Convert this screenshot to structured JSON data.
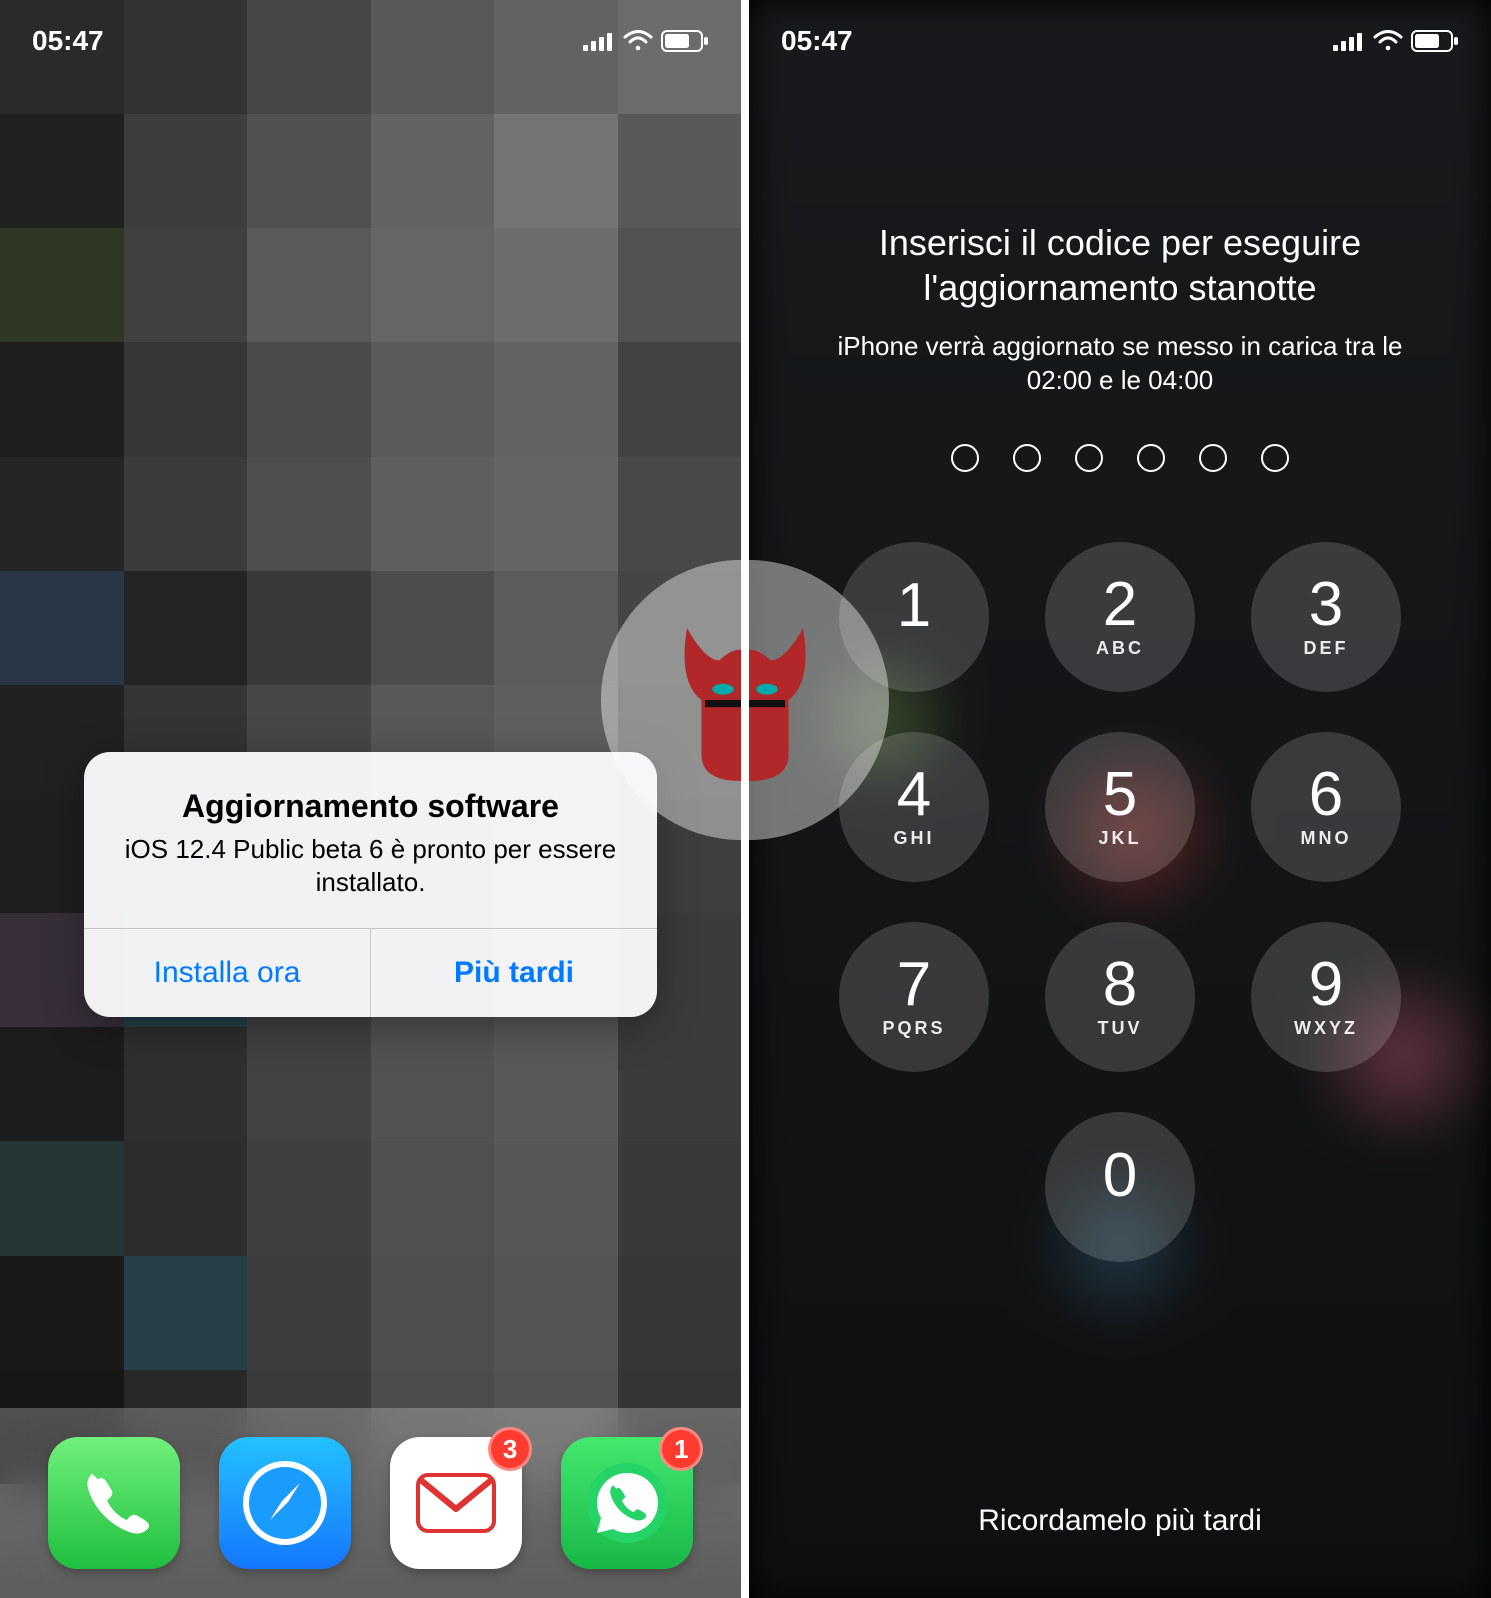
{
  "status": {
    "time": "05:47"
  },
  "left": {
    "alert": {
      "title": "Aggiornamento software",
      "message": "iOS 12.4 Public beta 6 è pronto per essere installato.",
      "primary": "Installa ora",
      "secondary": "Più tardi"
    },
    "dock": {
      "items": [
        {
          "name": "phone",
          "color": "#34c759",
          "badge": null
        },
        {
          "name": "safari",
          "color": "#1a9cff",
          "badge": null
        },
        {
          "name": "mail",
          "color": "#ffffff",
          "badge": "3"
        },
        {
          "name": "whatsapp",
          "color": "#25d366",
          "badge": "1"
        }
      ]
    }
  },
  "right": {
    "title": "Inserisci il codice per eseguire l'aggiornamento stanotte",
    "subtitle": "iPhone verrà aggiornato se messo in carica tra le 02:00 e le 04:00",
    "passcode_length": 6,
    "keypad": [
      {
        "digit": "1",
        "letters": ""
      },
      {
        "digit": "2",
        "letters": "ABC"
      },
      {
        "digit": "3",
        "letters": "DEF"
      },
      {
        "digit": "4",
        "letters": "GHI"
      },
      {
        "digit": "5",
        "letters": "JKL"
      },
      {
        "digit": "6",
        "letters": "MNO"
      },
      {
        "digit": "7",
        "letters": "PQRS"
      },
      {
        "digit": "8",
        "letters": "TUV"
      },
      {
        "digit": "9",
        "letters": "WXYZ"
      },
      {
        "digit": "",
        "letters": ""
      },
      {
        "digit": "0",
        "letters": ""
      },
      {
        "digit": "",
        "letters": ""
      }
    ],
    "remind": "Ricordamelo più tardi"
  },
  "mosaic_colors": [
    "#444",
    "#555",
    "#777",
    "#999",
    "#aaa",
    "#bbb",
    "#333",
    "#666",
    "#888",
    "#aaa",
    "#ccc",
    "#999",
    "#4b5a3a",
    "#6b6b6b",
    "#9a9a9a",
    "#b0b0b0",
    "#bcbcbc",
    "#8c8c8c",
    "#2e2e2e",
    "#5a5a5a",
    "#7e7e7e",
    "#9c9c9c",
    "#a8a8a8",
    "#707070",
    "#3b3b3b",
    "#626262",
    "#848484",
    "#a2a2a2",
    "#aeaeae",
    "#7a7a7a",
    "#3f5a7a",
    "#3a3a3a",
    "#5e5e5e",
    "#808080",
    "#9e9e9e",
    "#747474",
    "#343434",
    "#565656",
    "#787878",
    "#969696",
    "#a4a4a4",
    "#6e6e6e",
    "#303030",
    "#525252",
    "#747474",
    "#929292",
    "#9e9e9e",
    "#686868",
    "#5b4a60",
    "#3d6a7a",
    "#6e6e6e",
    "#8c8c8c",
    "#989898",
    "#626262",
    "#2a2a2a",
    "#4c4c4c",
    "#6e6e6e",
    "#8c8c8c",
    "#989898",
    "#626262",
    "#3a5a5a",
    "#484848",
    "#6a6a6a",
    "#888888",
    "#949494",
    "#5e5e5e",
    "#262626",
    "#3d6a7a",
    "#666666",
    "#848484",
    "#909090",
    "#5a5a5a",
    "#222",
    "#404040",
    "#626262",
    "#808080",
    "#8c8c8c",
    "#565656",
    "#707070",
    "#707070",
    "#707070",
    "#707070",
    "#707070",
    "#707070"
  ]
}
